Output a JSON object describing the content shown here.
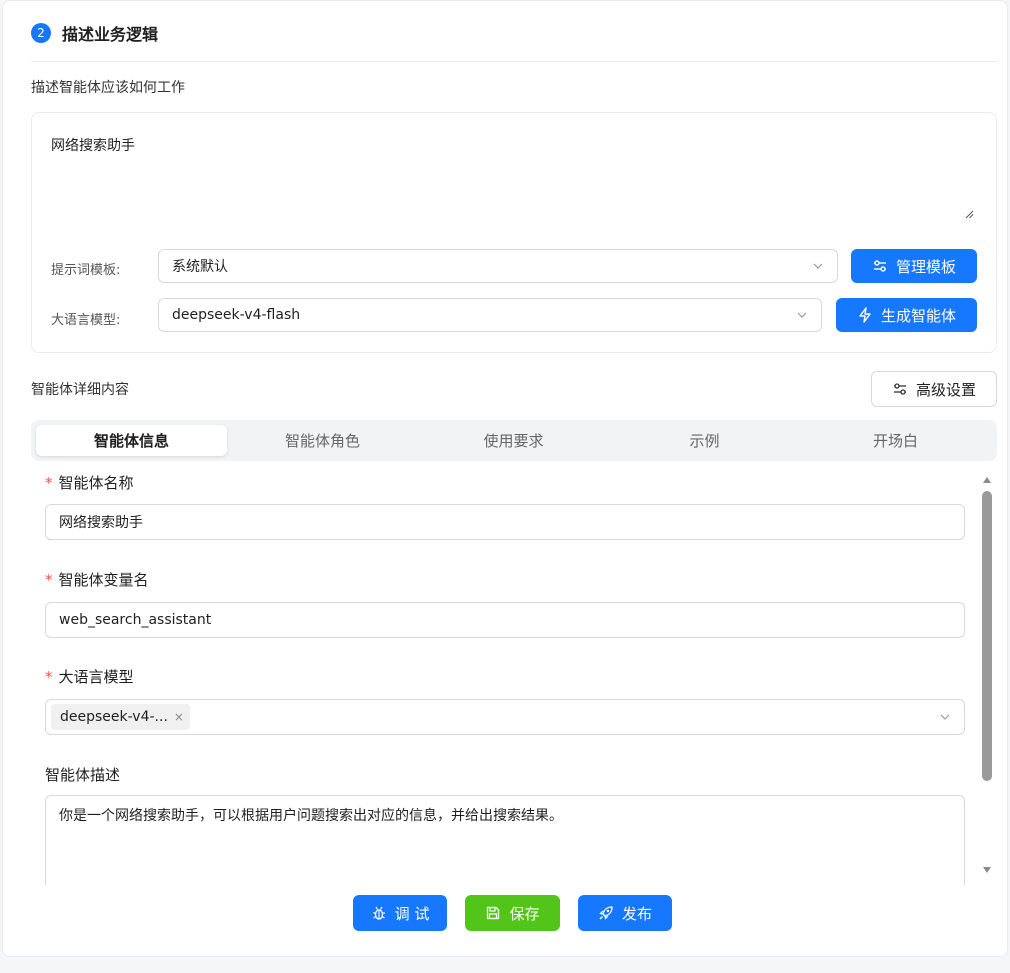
{
  "step": {
    "number": "2",
    "title": "描述业务逻辑"
  },
  "describe_label": "描述智能体应该如何工作",
  "prompt": {
    "text": "网络搜索助手",
    "template_label": "提示词模板:",
    "template_value": "系统默认",
    "manage_template_button": "管理模板",
    "llm_label": "大语言模型:",
    "llm_value": "deepseek-v4-flash",
    "generate_button": "生成智能体"
  },
  "details": {
    "title": "智能体详细内容",
    "advanced_button": "高级设置"
  },
  "tabs": [
    {
      "label": "智能体信息",
      "active": true
    },
    {
      "label": "智能体角色",
      "active": false
    },
    {
      "label": "使用要求",
      "active": false
    },
    {
      "label": "示例",
      "active": false
    },
    {
      "label": "开场白",
      "active": false
    }
  ],
  "form": {
    "required_mark": "*",
    "name_label": "智能体名称",
    "name_value": "网络搜索助手",
    "var_label": "智能体变量名",
    "var_value": "web_search_assistant",
    "model_label": "大语言模型",
    "model_tag": "deepseek-v4-...",
    "model_tag_close": "×",
    "desc_label": "智能体描述",
    "desc_value": "你是一个网络搜索助手，可以根据用户问题搜索出对应的信息，并给出搜索结果。"
  },
  "footer": {
    "debug_button": "调 试",
    "save_button": "保存",
    "publish_button": "发布"
  },
  "colors": {
    "primary": "#1677ff",
    "success": "#52c41a",
    "required": "#ff4d4f"
  },
  "icons": [
    "sliders-icon",
    "lightning-icon",
    "bug-icon",
    "save-icon",
    "rocket-icon",
    "chevron-down-icon",
    "close-icon"
  ]
}
